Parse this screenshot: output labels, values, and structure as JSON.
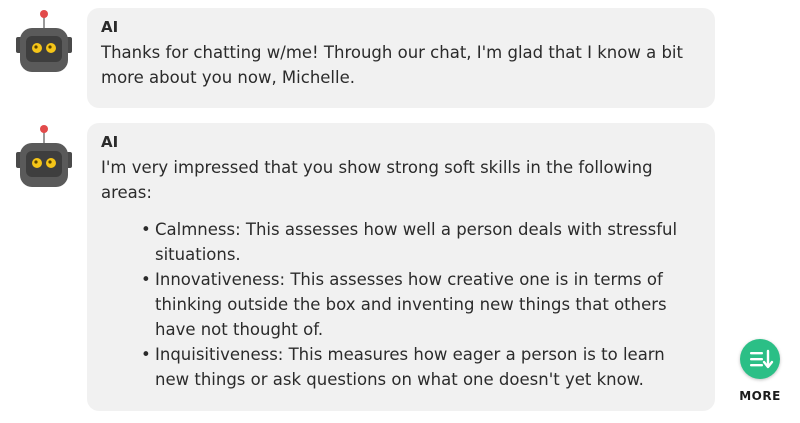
{
  "messages": [
    {
      "sender": "AI",
      "text": "Thanks for chatting w/me! Through our chat, I'm glad that I know a bit more about you now, Michelle."
    },
    {
      "sender": "AI",
      "text": "I'm very impressed that you show strong soft skills in the following areas:",
      "bullets": [
        "Calmness: This assesses how well a person deals with stressful situations.",
        "Innovativeness: This assesses how creative one is in terms of thinking outside the box and inventing new things that others have not thought of.",
        "Inquisitiveness: This measures how eager a person is to learn new things or ask questions on what one doesn't yet know."
      ]
    }
  ],
  "more_button": {
    "label": "MORE",
    "icon": "list-scroll-down-icon",
    "color": "#2bbf86"
  },
  "avatar": {
    "icon": "robot-icon",
    "body_color": "#555555",
    "eye_color": "#f5c518",
    "antenna_color": "#e24b4b"
  },
  "bubble_color": "#f1f1f1"
}
